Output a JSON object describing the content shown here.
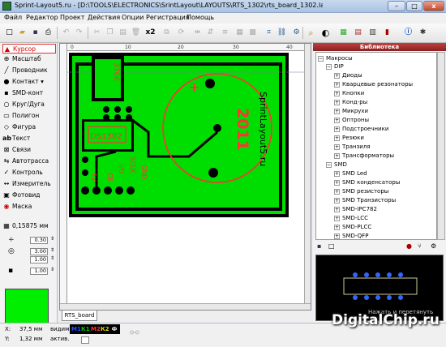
{
  "window": {
    "title": "Sprint-Layout5.ru - [D:\\TOOLS\\ELECTRONICS\\SrintLayout\\LAYOUTS\\RTS_1302\\rts_board_1302.lay]",
    "min": "–",
    "max": "□",
    "close": "x"
  },
  "menu": [
    "Файл",
    "Редактор",
    "Проект",
    "Действия",
    "Опции",
    "Регистрация",
    "Помощь"
  ],
  "toolbar": {
    "zoom_label": "x2"
  },
  "ruler": {
    "top_ticks": [
      "0",
      "10",
      "20",
      "30",
      "40"
    ]
  },
  "tools": [
    {
      "label": "Курсор",
      "icon": "▲"
    },
    {
      "label": "Масштаб",
      "icon": "⊕"
    },
    {
      "label": "Проводник",
      "icon": "╱"
    },
    {
      "label": "Контакт",
      "icon": "●"
    },
    {
      "label": "SMD-конт",
      "icon": "▪"
    },
    {
      "label": "Круг/Дуга",
      "icon": "○"
    },
    {
      "label": "Полигон",
      "icon": "▭"
    },
    {
      "label": "Фигура",
      "icon": "◇"
    },
    {
      "label": "Текст",
      "icon": "ab"
    },
    {
      "label": "Связи",
      "icon": "⊠"
    },
    {
      "label": "Автотрасса",
      "icon": "⇆"
    },
    {
      "label": "Контроль",
      "icon": "✓"
    },
    {
      "label": "Измеритель",
      "icon": "↔"
    },
    {
      "label": "Фотовид",
      "icon": "▣"
    },
    {
      "label": "Маска",
      "icon": "◉"
    }
  ],
  "grid": {
    "value": "0,15875 мм"
  },
  "params": [
    {
      "value": "0.30"
    },
    {
      "value": "3.00"
    },
    {
      "value": "1.00"
    },
    {
      "value": "1.00"
    }
  ],
  "board": {
    "tab_name": "RTS_board",
    "texts": {
      "chip": "DS1302",
      "cap": "3768",
      "plus": "+",
      "gnd": "GND",
      "sclk": "SCLK",
      "i_o": "I/O",
      "ce": "CE",
      "five_v": "5V",
      "year": "2011",
      "url": "SprintLayout5.ru"
    }
  },
  "library": {
    "header": "Библиотека",
    "root": "Макросы",
    "groups": [
      {
        "name": "DIP",
        "items": [
          "Диоды",
          "Кварцевые резонаторы",
          "Кнопки",
          "Конд-ры",
          "Микрухи",
          "Оптроны",
          "Подстроечники",
          "Резюки",
          "Транзиля",
          "Трансформаторы"
        ]
      },
      {
        "name": "SMD",
        "items": [
          "SMD Led",
          "SMD конденсаторы",
          "SMD резисторы",
          "SMD Транзисторы",
          "SMD-IPC782",
          "SMD-LCC",
          "SMD-PLCC",
          "SMD-QFP",
          "SMD-SOJ"
        ]
      }
    ],
    "preview_hint": "Нажать и перетянуть"
  },
  "status": {
    "x_label": "X:",
    "x_val": "37,5 мм",
    "y_label": "Y:",
    "y_val": "1,32 мм",
    "visible": "видим.",
    "active": "актив.",
    "layers": [
      {
        "name": "М1",
        "color": "#2255ff"
      },
      {
        "name": "К1",
        "color": "#00cc00"
      },
      {
        "name": "М2",
        "color": "#ff3333"
      },
      {
        "name": "К2",
        "color": "#dddd00"
      },
      {
        "name": "Ф",
        "color": "#dddddd"
      }
    ]
  },
  "watermark": "DigitalChip.ru"
}
